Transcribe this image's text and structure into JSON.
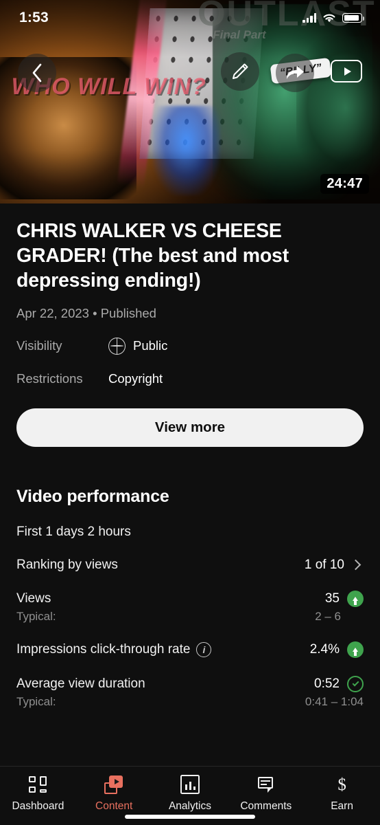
{
  "status_bar": {
    "time": "1:53",
    "icons": [
      "cellular-signal-icon",
      "wifi-icon",
      "battery-icon"
    ]
  },
  "hero": {
    "thumbnail_text": {
      "top_title": "OUTLAST",
      "subtitle": "Final Part",
      "headline": "WHO WILL WIN?",
      "sticker": "“BILLY”"
    },
    "duration": "24:47",
    "controls": [
      {
        "name": "back-button",
        "icon": "chevron-left-icon"
      },
      {
        "name": "edit-button",
        "icon": "pencil-icon"
      },
      {
        "name": "share-button",
        "icon": "share-arrow-icon"
      },
      {
        "name": "watch-on-youtube-button",
        "icon": "youtube-play-icon"
      }
    ]
  },
  "video": {
    "title": "CHRIS WALKER VS CHEESE GRADER! (The best and most depressing ending!)",
    "meta": "Apr 22, 2023 • Published",
    "details": [
      {
        "key": "Visibility",
        "value": "Public",
        "icon": "globe-icon"
      },
      {
        "key": "Restrictions",
        "value": "Copyright",
        "icon": null
      }
    ],
    "view_more_label": "View more"
  },
  "performance": {
    "heading": "Video performance",
    "subheading": "First 1 days 2 hours",
    "ranking": {
      "label": "Ranking by views",
      "value": "1 of 10",
      "chevron": "chevron-right-icon"
    },
    "metrics": [
      {
        "label": "Views",
        "value": "35",
        "badge": "up-arrow-badge",
        "typical_label": "Typical:",
        "typical_value": "2 – 6",
        "info": false
      },
      {
        "label": "Impressions click-through rate",
        "value": "2.4%",
        "badge": "up-arrow-badge",
        "typical_label": null,
        "typical_value": null,
        "info": true
      },
      {
        "label": "Average view duration",
        "value": "0:52",
        "badge": "check-badge",
        "typical_label": "Typical:",
        "typical_value": "0:41 – 1:04",
        "info": false
      }
    ]
  },
  "tabbar": {
    "items": [
      {
        "label": "Dashboard",
        "icon": "dashboard-grid-icon",
        "active": false
      },
      {
        "label": "Content",
        "icon": "content-video-icon",
        "active": true
      },
      {
        "label": "Analytics",
        "icon": "analytics-bars-icon",
        "active": false
      },
      {
        "label": "Comments",
        "icon": "comment-bubble-icon",
        "active": false
      },
      {
        "label": "Earn",
        "icon": "dollar-sign-icon",
        "active": false
      }
    ]
  },
  "colors": {
    "background": "#0f0f0f",
    "accent_active": "#e8705f",
    "positive": "#3fa34d",
    "primary_text": "#f1f1f1",
    "secondary_text": "#aaaaaa",
    "button_fill": "#f1f1f1"
  }
}
